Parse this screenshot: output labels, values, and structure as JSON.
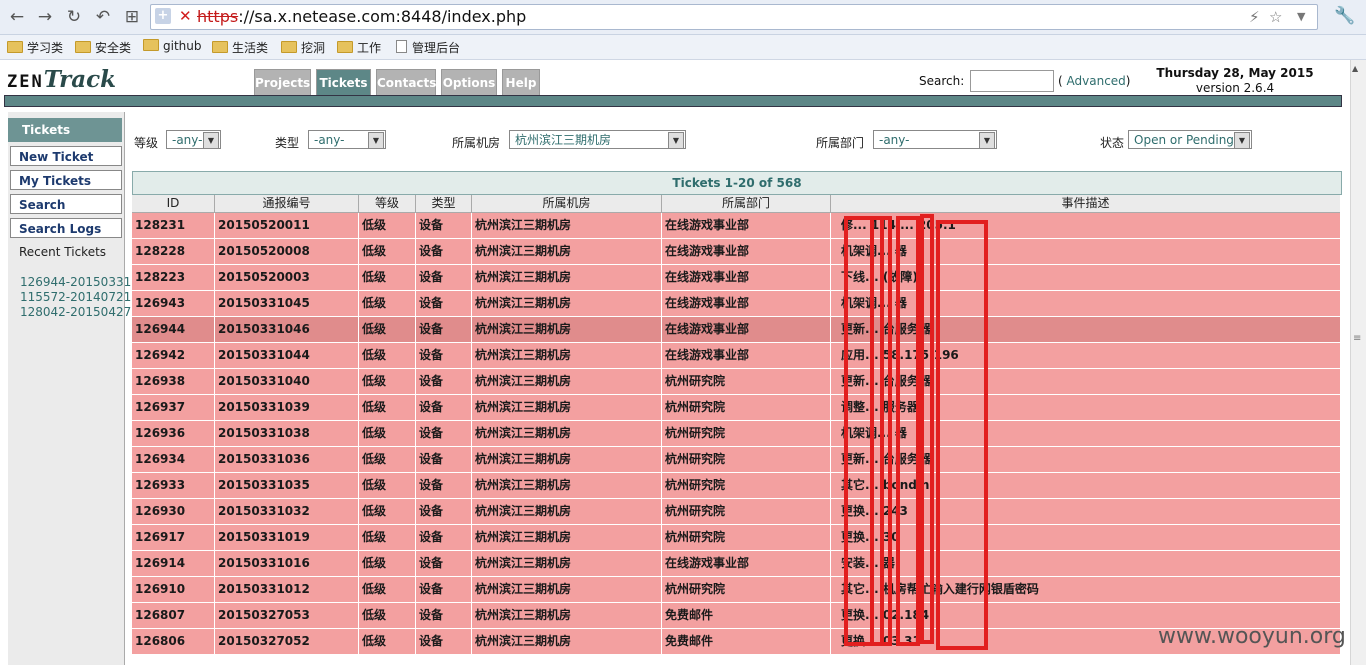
{
  "browser": {
    "url_scheme": "https",
    "url_rest": "://sa.x.netease.com:8448/index.php",
    "icons": [
      "back-icon",
      "forward-icon",
      "reload-icon",
      "undo-icon",
      "grid-icon",
      "star-icon",
      "wrench-icon"
    ],
    "bookmarks": [
      {
        "label": "学习类",
        "icon": "folder-icon"
      },
      {
        "label": "安全类",
        "icon": "folder-icon"
      },
      {
        "label": "github",
        "icon": "folder-icon"
      },
      {
        "label": "生活类",
        "icon": "folder-icon"
      },
      {
        "label": "挖洞",
        "icon": "folder-icon"
      },
      {
        "label": "工作",
        "icon": "folder-icon"
      },
      {
        "label": "管理后台",
        "icon": "page-icon"
      }
    ]
  },
  "header": {
    "logo_part1": "ZEN",
    "logo_part2": "Track",
    "tabs": [
      "Projects",
      "Tickets",
      "Contacts",
      "Options",
      "Help"
    ],
    "active_tab": "Tickets",
    "search_label": "Search:",
    "advanced_open": "(",
    "advanced_link": "Advanced",
    "advanced_close": ")",
    "date": "Thursday 28, May 2015",
    "version": "version 2.6.4"
  },
  "sidebar": {
    "heading": "Tickets",
    "buttons": [
      "New Ticket",
      "My Tickets",
      "Search",
      "Search Logs"
    ],
    "recent_title": "Recent Tickets",
    "recent": [
      "126944-20150331",
      "115572-20140721",
      "128042-20150427"
    ]
  },
  "filters": [
    {
      "label": "等级",
      "value": "-any-"
    },
    {
      "label": "类型",
      "value": "-any-"
    },
    {
      "label": "所属机房",
      "value": "杭州滨江三期机房"
    },
    {
      "label": "所属部门",
      "value": "-any-"
    },
    {
      "label": "状态",
      "value": "Open or Pending"
    }
  ],
  "table": {
    "title": "Tickets 1-20 of 568",
    "columns": [
      "ID",
      "通报编号",
      "等级",
      "类型",
      "所属机房",
      "所属部门",
      "事件描述"
    ],
    "rows": [
      [
        "128231",
        "20150520011",
        "低级",
        "设备",
        "杭州滨江三期机房",
        "在线游戏事业部",
        "修... 114 ... 205.1"
      ],
      [
        "128228",
        "20150520008",
        "低级",
        "设备",
        "杭州滨江三期机房",
        "在线游戏事业部",
        "机架调... 器"
      ],
      [
        "128223",
        "20150520003",
        "低级",
        "设备",
        "杭州滨江三期机房",
        "在线游戏事业部",
        "下线... (故障)"
      ],
      [
        "126943",
        "20150331045",
        "低级",
        "设备",
        "杭州滨江三期机房",
        "在线游戏事业部",
        "机架调... 器"
      ],
      [
        "126944",
        "20150331046",
        "低级",
        "设备",
        "杭州滨江三期机房",
        "在线游戏事业部",
        "更新... 台服务器"
      ],
      [
        "126942",
        "20150331044",
        "低级",
        "设备",
        "杭州滨江三期机房",
        "在线游戏事业部",
        "应用... 58.175.196"
      ],
      [
        "126938",
        "20150331040",
        "低级",
        "设备",
        "杭州滨江三期机房",
        "杭州研究院",
        "更新... 台服务器"
      ],
      [
        "126937",
        "20150331039",
        "低级",
        "设备",
        "杭州滨江三期机房",
        "杭州研究院",
        "调整... 服务器"
      ],
      [
        "126936",
        "20150331038",
        "低级",
        "设备",
        "杭州滨江三期机房",
        "杭州研究院",
        "机架调... 器"
      ],
      [
        "126934",
        "20150331036",
        "低级",
        "设备",
        "杭州滨江三期机房",
        "杭州研究院",
        "更新... 台服务器"
      ],
      [
        "126933",
        "20150331035",
        "低级",
        "设备",
        "杭州滨江三期机房",
        "杭州研究院",
        "其它... bondin"
      ],
      [
        "126930",
        "20150331032",
        "低级",
        "设备",
        "杭州滨江三期机房",
        "杭州研究院",
        "更换... 243"
      ],
      [
        "126917",
        "20150331019",
        "低级",
        "设备",
        "杭州滨江三期机房",
        "杭州研究院",
        "更换... 30"
      ],
      [
        "126914",
        "20150331016",
        "低级",
        "设备",
        "杭州滨江三期机房",
        "在线游戏事业部",
        "安装... 器"
      ],
      [
        "126910",
        "20150331012",
        "低级",
        "设备",
        "杭州滨江三期机房",
        "杭州研究院",
        "其它... 机房帮忙输入建行网银盾密码"
      ],
      [
        "126807",
        "20150327053",
        "低级",
        "设备",
        "杭州滨江三期机房",
        "免费邮件",
        "更换... 02.184"
      ],
      [
        "126806",
        "20150327052",
        "低级",
        "设备",
        "杭州滨江三期机房",
        "免费邮件",
        "更换... 03.31"
      ]
    ],
    "highlighted_row": 4
  },
  "watermark": "www.wooyun.org",
  "colors": {
    "row_bg": "#f3a0a0",
    "accent": "#5d8787",
    "redaction": "#e21f1f"
  }
}
